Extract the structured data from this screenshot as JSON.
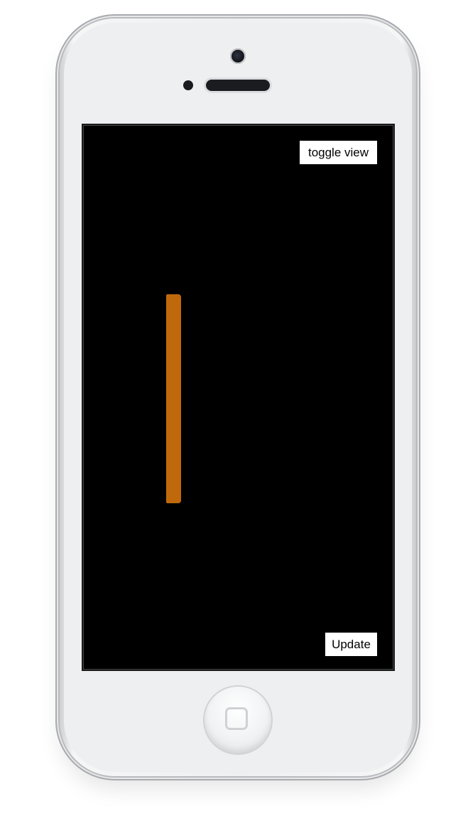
{
  "screen": {
    "toggle_label": "toggle view",
    "update_label": "Update",
    "background_color": "#000000",
    "bar_color": "#c0690c"
  },
  "device": {
    "body_color": "#eeeff1",
    "home_button_icon": "home-square-icon"
  }
}
